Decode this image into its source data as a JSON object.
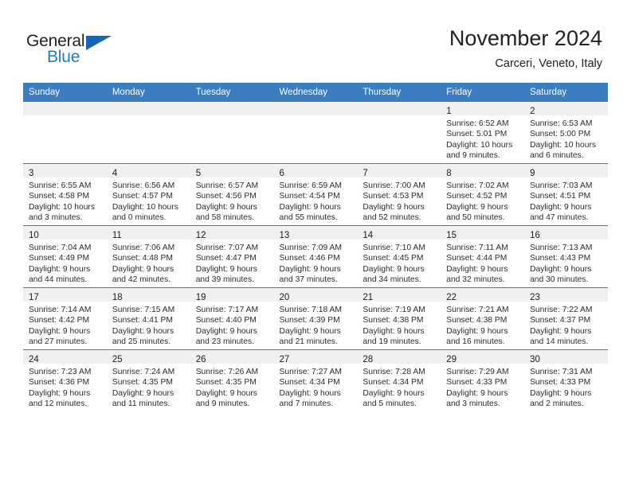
{
  "brand": {
    "name_part1": "General",
    "name_part2": "Blue",
    "triangle_color": "#1268b3",
    "blue_color": "#1a7fc1"
  },
  "header": {
    "title": "November 2024",
    "subtitle": "Carceri, Veneto, Italy"
  },
  "theme": {
    "header_blue": "#3a7dc0",
    "daynum_band": "#f0f0f0",
    "text": "#2b2b2b"
  },
  "weekday_headers": [
    "Sunday",
    "Monday",
    "Tuesday",
    "Wednesday",
    "Thursday",
    "Friday",
    "Saturday"
  ],
  "labels": {
    "sunrise_prefix": "Sunrise:",
    "sunset_prefix": "Sunset:",
    "daylight_prefix": "Daylight:"
  },
  "weeks": [
    [
      {
        "day": "",
        "empty": true
      },
      {
        "day": "",
        "empty": true
      },
      {
        "day": "",
        "empty": true
      },
      {
        "day": "",
        "empty": true
      },
      {
        "day": "",
        "empty": true
      },
      {
        "day": "1",
        "sunrise": "Sunrise: 6:52 AM",
        "sunset": "Sunset: 5:01 PM",
        "daylight1": "Daylight: 10 hours",
        "daylight2": "and 9 minutes."
      },
      {
        "day": "2",
        "sunrise": "Sunrise: 6:53 AM",
        "sunset": "Sunset: 5:00 PM",
        "daylight1": "Daylight: 10 hours",
        "daylight2": "and 6 minutes."
      }
    ],
    [
      {
        "day": "3",
        "sunrise": "Sunrise: 6:55 AM",
        "sunset": "Sunset: 4:58 PM",
        "daylight1": "Daylight: 10 hours",
        "daylight2": "and 3 minutes."
      },
      {
        "day": "4",
        "sunrise": "Sunrise: 6:56 AM",
        "sunset": "Sunset: 4:57 PM",
        "daylight1": "Daylight: 10 hours",
        "daylight2": "and 0 minutes."
      },
      {
        "day": "5",
        "sunrise": "Sunrise: 6:57 AM",
        "sunset": "Sunset: 4:56 PM",
        "daylight1": "Daylight: 9 hours",
        "daylight2": "and 58 minutes."
      },
      {
        "day": "6",
        "sunrise": "Sunrise: 6:59 AM",
        "sunset": "Sunset: 4:54 PM",
        "daylight1": "Daylight: 9 hours",
        "daylight2": "and 55 minutes."
      },
      {
        "day": "7",
        "sunrise": "Sunrise: 7:00 AM",
        "sunset": "Sunset: 4:53 PM",
        "daylight1": "Daylight: 9 hours",
        "daylight2": "and 52 minutes."
      },
      {
        "day": "8",
        "sunrise": "Sunrise: 7:02 AM",
        "sunset": "Sunset: 4:52 PM",
        "daylight1": "Daylight: 9 hours",
        "daylight2": "and 50 minutes."
      },
      {
        "day": "9",
        "sunrise": "Sunrise: 7:03 AM",
        "sunset": "Sunset: 4:51 PM",
        "daylight1": "Daylight: 9 hours",
        "daylight2": "and 47 minutes."
      }
    ],
    [
      {
        "day": "10",
        "sunrise": "Sunrise: 7:04 AM",
        "sunset": "Sunset: 4:49 PM",
        "daylight1": "Daylight: 9 hours",
        "daylight2": "and 44 minutes."
      },
      {
        "day": "11",
        "sunrise": "Sunrise: 7:06 AM",
        "sunset": "Sunset: 4:48 PM",
        "daylight1": "Daylight: 9 hours",
        "daylight2": "and 42 minutes."
      },
      {
        "day": "12",
        "sunrise": "Sunrise: 7:07 AM",
        "sunset": "Sunset: 4:47 PM",
        "daylight1": "Daylight: 9 hours",
        "daylight2": "and 39 minutes."
      },
      {
        "day": "13",
        "sunrise": "Sunrise: 7:09 AM",
        "sunset": "Sunset: 4:46 PM",
        "daylight1": "Daylight: 9 hours",
        "daylight2": "and 37 minutes."
      },
      {
        "day": "14",
        "sunrise": "Sunrise: 7:10 AM",
        "sunset": "Sunset: 4:45 PM",
        "daylight1": "Daylight: 9 hours",
        "daylight2": "and 34 minutes."
      },
      {
        "day": "15",
        "sunrise": "Sunrise: 7:11 AM",
        "sunset": "Sunset: 4:44 PM",
        "daylight1": "Daylight: 9 hours",
        "daylight2": "and 32 minutes."
      },
      {
        "day": "16",
        "sunrise": "Sunrise: 7:13 AM",
        "sunset": "Sunset: 4:43 PM",
        "daylight1": "Daylight: 9 hours",
        "daylight2": "and 30 minutes."
      }
    ],
    [
      {
        "day": "17",
        "sunrise": "Sunrise: 7:14 AM",
        "sunset": "Sunset: 4:42 PM",
        "daylight1": "Daylight: 9 hours",
        "daylight2": "and 27 minutes."
      },
      {
        "day": "18",
        "sunrise": "Sunrise: 7:15 AM",
        "sunset": "Sunset: 4:41 PM",
        "daylight1": "Daylight: 9 hours",
        "daylight2": "and 25 minutes."
      },
      {
        "day": "19",
        "sunrise": "Sunrise: 7:17 AM",
        "sunset": "Sunset: 4:40 PM",
        "daylight1": "Daylight: 9 hours",
        "daylight2": "and 23 minutes."
      },
      {
        "day": "20",
        "sunrise": "Sunrise: 7:18 AM",
        "sunset": "Sunset: 4:39 PM",
        "daylight1": "Daylight: 9 hours",
        "daylight2": "and 21 minutes."
      },
      {
        "day": "21",
        "sunrise": "Sunrise: 7:19 AM",
        "sunset": "Sunset: 4:38 PM",
        "daylight1": "Daylight: 9 hours",
        "daylight2": "and 19 minutes."
      },
      {
        "day": "22",
        "sunrise": "Sunrise: 7:21 AM",
        "sunset": "Sunset: 4:38 PM",
        "daylight1": "Daylight: 9 hours",
        "daylight2": "and 16 minutes."
      },
      {
        "day": "23",
        "sunrise": "Sunrise: 7:22 AM",
        "sunset": "Sunset: 4:37 PM",
        "daylight1": "Daylight: 9 hours",
        "daylight2": "and 14 minutes."
      }
    ],
    [
      {
        "day": "24",
        "sunrise": "Sunrise: 7:23 AM",
        "sunset": "Sunset: 4:36 PM",
        "daylight1": "Daylight: 9 hours",
        "daylight2": "and 12 minutes."
      },
      {
        "day": "25",
        "sunrise": "Sunrise: 7:24 AM",
        "sunset": "Sunset: 4:35 PM",
        "daylight1": "Daylight: 9 hours",
        "daylight2": "and 11 minutes."
      },
      {
        "day": "26",
        "sunrise": "Sunrise: 7:26 AM",
        "sunset": "Sunset: 4:35 PM",
        "daylight1": "Daylight: 9 hours",
        "daylight2": "and 9 minutes."
      },
      {
        "day": "27",
        "sunrise": "Sunrise: 7:27 AM",
        "sunset": "Sunset: 4:34 PM",
        "daylight1": "Daylight: 9 hours",
        "daylight2": "and 7 minutes."
      },
      {
        "day": "28",
        "sunrise": "Sunrise: 7:28 AM",
        "sunset": "Sunset: 4:34 PM",
        "daylight1": "Daylight: 9 hours",
        "daylight2": "and 5 minutes."
      },
      {
        "day": "29",
        "sunrise": "Sunrise: 7:29 AM",
        "sunset": "Sunset: 4:33 PM",
        "daylight1": "Daylight: 9 hours",
        "daylight2": "and 3 minutes."
      },
      {
        "day": "30",
        "sunrise": "Sunrise: 7:31 AM",
        "sunset": "Sunset: 4:33 PM",
        "daylight1": "Daylight: 9 hours",
        "daylight2": "and 2 minutes."
      }
    ]
  ]
}
